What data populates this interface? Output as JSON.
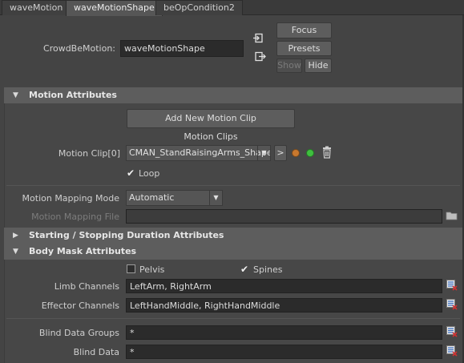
{
  "tabs": [
    {
      "label": "waveMotion",
      "active": false
    },
    {
      "label": "waveMotionShape",
      "active": true
    },
    {
      "label": "beOpCondition2",
      "active": false
    }
  ],
  "header": {
    "node_label": "CrowdBeMotion:",
    "node_value": "waveMotionShape",
    "focus_label": "Focus",
    "presets_label": "Presets",
    "show_label": "Show",
    "hide_label": "Hide"
  },
  "motion_attributes": {
    "title": "Motion Attributes",
    "add_clip_label": "Add New Motion Clip",
    "clips_heading": "Motion Clips",
    "clip_label": "Motion Clip[0]",
    "clip_value": "CMAN_StandRaisingArms_Shape",
    "go_label": ">",
    "loop_label": "Loop",
    "loop_checked": true,
    "mapping_mode_label": "Motion Mapping Mode",
    "mapping_mode_value": "Automatic",
    "mapping_file_label": "Motion Mapping File",
    "mapping_file_value": ""
  },
  "starting_stopping": {
    "title": "Starting / Stopping Duration Attributes"
  },
  "body_mask": {
    "title": "Body Mask Attributes",
    "pelvis_label": "Pelvis",
    "pelvis_checked": false,
    "spines_label": "Spines",
    "spines_checked": true,
    "limb_label": "Limb Channels",
    "limb_value": "LeftArm, RightArm",
    "effector_label": "Effector Channels",
    "effector_value": "LeftHandMiddle, RightHandMiddle",
    "blind_groups_label": "Blind Data Groups",
    "blind_groups_value": "*",
    "blind_data_label": "Blind Data",
    "blind_data_value": "*"
  },
  "colors": {
    "orange_dot": "#c8782e",
    "green_dot": "#3fbf3f"
  }
}
